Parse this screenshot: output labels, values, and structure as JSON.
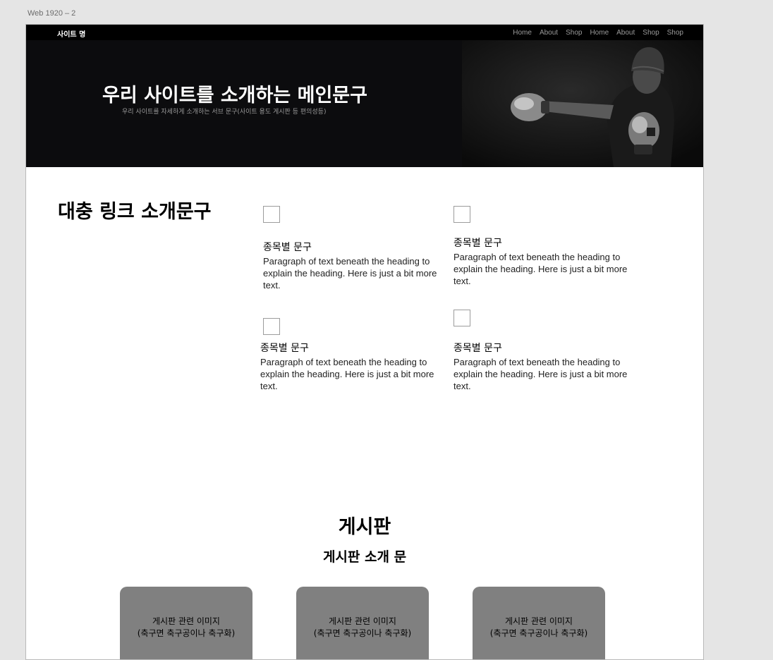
{
  "artboard": {
    "label": "Web 1920 – 2"
  },
  "header": {
    "site_name": "사이트 명",
    "nav": [
      "Home",
      "About",
      "Shop",
      "Home",
      "About",
      "Shop",
      "Shop"
    ]
  },
  "hero": {
    "title": "우리 사이트를 소개하는 메인문구",
    "subtitle": "우리 사이트를 자세하게 소개하는 서브 문구(사이트 용도 게시판 등 편의성등)",
    "image": "boxer-photo"
  },
  "intro": {
    "heading": "대충 링크 소개문구",
    "features": [
      {
        "title": "종목별 문구",
        "text": "Paragraph of text beneath the heading to explain the heading. Here is just a bit more text."
      },
      {
        "title": "종목별 문구",
        "text": "Paragraph of text beneath the heading to explain the heading. Here is just a bit more text."
      },
      {
        "title": "종목별 문구",
        "text": "Paragraph of text beneath the heading to explain the heading. Here is just a bit more text."
      },
      {
        "title": "종목별 문구",
        "text": "Paragraph of text beneath the heading to explain the heading. Here is just a bit more text."
      }
    ]
  },
  "board": {
    "title": "게시판",
    "subtitle": "게시판 소개 문",
    "cards": [
      {
        "line1": "게시판 관련 이미지",
        "line2": "(축구면 축구공이나 축구화)"
      },
      {
        "line1": "게시판 관련 이미지",
        "line2": "(축구면 축구공이나 축구화)"
      },
      {
        "line1": "게시판 관련 이미지",
        "line2": "(축구면 축구공이나 축구화)"
      }
    ]
  },
  "colors": {
    "canvas": "#e5e5e5",
    "topbar": "#000000",
    "hero_bg": "#0c0c0e",
    "card_bg": "#808080"
  }
}
